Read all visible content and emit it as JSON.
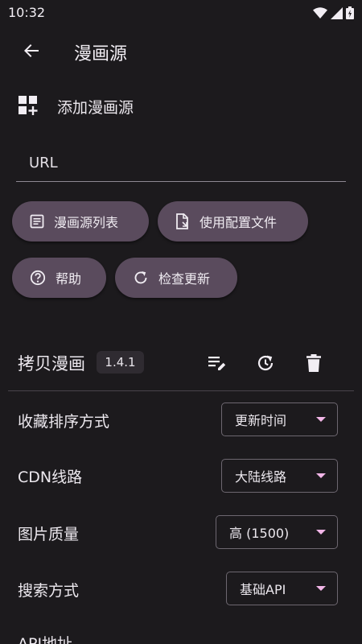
{
  "status_bar": {
    "time": "10:32"
  },
  "app_bar": {
    "title": "漫画源"
  },
  "add_source": {
    "label": "添加漫画源"
  },
  "url_input": {
    "placeholder": "URL",
    "value": ""
  },
  "buttons": {
    "source_list": "漫画源列表",
    "use_config": "使用配置文件",
    "help": "帮助",
    "check_update": "检查更新"
  },
  "source": {
    "name": "拷贝漫画",
    "version": "1.4.1"
  },
  "settings": [
    {
      "label": "收藏排序方式",
      "value": "更新时间"
    },
    {
      "label": "CDN线路",
      "value": "大陆线路"
    },
    {
      "label": "图片质量",
      "value": "高 (1500)"
    },
    {
      "label": "搜索方式",
      "value": "基础API"
    },
    {
      "label": "API地址"
    }
  ],
  "colors": {
    "background": "#1c1a1d",
    "chip": "#5a4b5d",
    "dropdown_arrow": "#f2b6e8",
    "badge": "#2f2b31"
  }
}
